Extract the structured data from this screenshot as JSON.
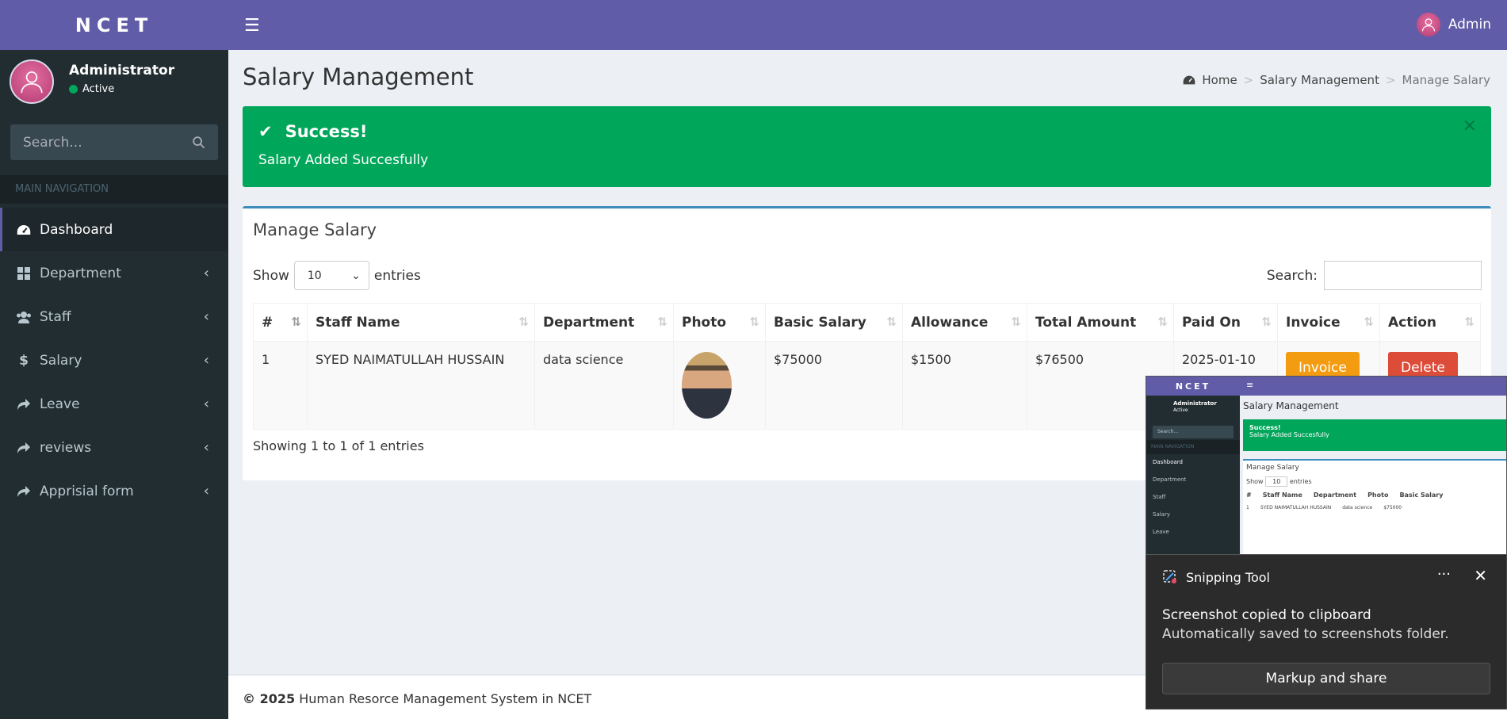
{
  "sidebar": {
    "logo": "NCET",
    "user_name": "Administrator",
    "user_status": "Active",
    "search_placeholder": "Search...",
    "nav_header": "MAIN NAVIGATION",
    "items": [
      {
        "label": "Dashboard",
        "icon": "dashboard-icon"
      },
      {
        "label": "Department",
        "icon": "grid-icon"
      },
      {
        "label": "Staff",
        "icon": "users-icon"
      },
      {
        "label": "Salary",
        "icon": "dollar-icon"
      },
      {
        "label": "Leave",
        "icon": "share-icon"
      },
      {
        "label": "reviews",
        "icon": "share-icon"
      },
      {
        "label": "Apprisial form",
        "icon": "share-icon"
      }
    ]
  },
  "topbar": {
    "user": "Admin"
  },
  "page": {
    "title": "Salary Management",
    "breadcrumb": [
      "Home",
      "Salary Management",
      "Manage Salary"
    ]
  },
  "alert": {
    "title": "Success!",
    "message": "Salary Added Succesfully"
  },
  "box": {
    "title": "Manage Salary",
    "show_label": "Show",
    "entries_value": "10",
    "entries_label": "entries",
    "search_label": "Search:",
    "info": "Showing 1 to 1 of 1 entries"
  },
  "table": {
    "headers": [
      "#",
      "Staff Name",
      "Department",
      "Photo",
      "Basic Salary",
      "Allowance",
      "Total Amount",
      "Paid On",
      "Invoice",
      "Action"
    ],
    "rows": [
      {
        "num": "1",
        "name": "SYED NAIMATULLAH HUSSAIN",
        "department": "data science",
        "basic": "$75000",
        "allowance": "$1500",
        "total": "$76500",
        "paid_on": "2025-01-10",
        "invoice_btn": "Invoice",
        "action_btn": "Delete"
      }
    ]
  },
  "footer": {
    "year": "© 2025",
    "text": "Human Resorce Management System in NCET"
  },
  "toast": {
    "app": "Snipping Tool",
    "line1": "Screenshot copied to clipboard",
    "line2": "Automatically saved to screenshots folder.",
    "button": "Markup and share",
    "more": "···",
    "close": "✕"
  },
  "preview": {
    "logo": "NCET",
    "hamb": "≡",
    "user": "Administrator",
    "status": "Active",
    "search": "Search...",
    "nav_header": "MAIN NAVIGATION",
    "title": "Salary Management",
    "alert_title": "Success!",
    "alert_msg": "Salary Added Succesfully",
    "box_title": "Manage Salary",
    "show": "Show",
    "entries_value": "10",
    "entries": "entries",
    "nav": [
      "Dashboard",
      "Department",
      "Staff",
      "Salary",
      "Leave"
    ],
    "headers": [
      "#",
      "Staff Name",
      "Department",
      "Photo",
      "Basic Salary"
    ],
    "row": [
      "1",
      "SYED NAIMATULLAH HUSSAIN",
      "data science",
      "$75000"
    ]
  },
  "colors": {
    "brand": "#605ca8",
    "sidebar": "#222d32",
    "success": "#00a65a",
    "warning": "#f39c12",
    "danger": "#dd4b39",
    "box_border": "#3c8dbc"
  }
}
